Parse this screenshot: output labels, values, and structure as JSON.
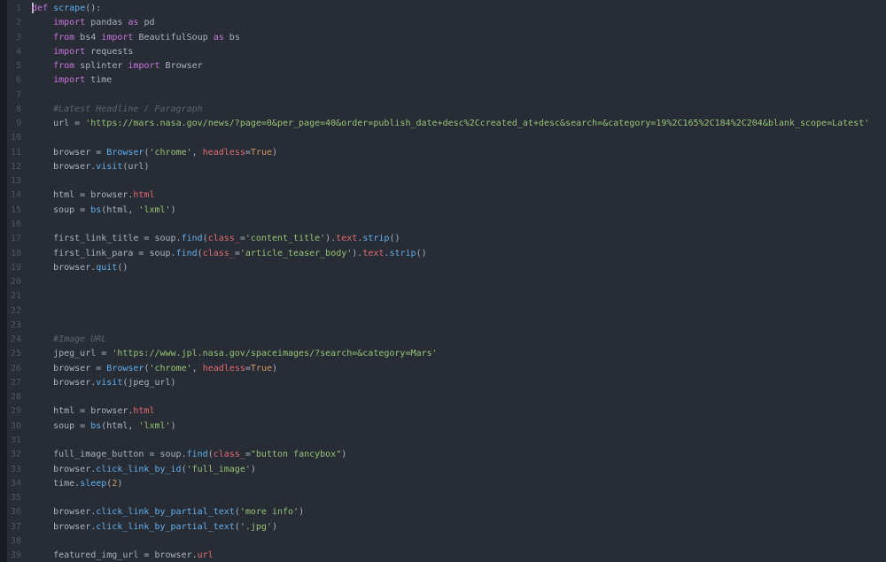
{
  "editor": {
    "colors": {
      "background": "#282c34",
      "left_edge": "#171a1f",
      "line_number": "#4d5666"
    },
    "token_colors": {
      "plain": "#abb2bf",
      "keyword": "#c678dd",
      "function": "#61afef",
      "string": "#98c379",
      "comment": "#5c6370",
      "property": "#e06c75",
      "argument": "#e06c75",
      "number": "#d19a66",
      "cursor": "#b6bdca"
    },
    "cursor_position": {
      "line": 1,
      "column": 1
    },
    "lines": [
      {
        "n": 1,
        "t": [
          [
            "cursor",
            ""
          ],
          [
            "keyword",
            "def"
          ],
          [
            "plain",
            " "
          ],
          [
            "function",
            "scrape"
          ],
          [
            "plain",
            "():"
          ]
        ]
      },
      {
        "n": 2,
        "t": [
          [
            "plain",
            "    "
          ],
          [
            "keyword",
            "import"
          ],
          [
            "plain",
            " pandas "
          ],
          [
            "keyword",
            "as"
          ],
          [
            "plain",
            " pd"
          ]
        ]
      },
      {
        "n": 3,
        "t": [
          [
            "plain",
            "    "
          ],
          [
            "keyword",
            "from"
          ],
          [
            "plain",
            " bs4 "
          ],
          [
            "keyword",
            "import"
          ],
          [
            "plain",
            " BeautifulSoup "
          ],
          [
            "keyword",
            "as"
          ],
          [
            "plain",
            " bs"
          ]
        ]
      },
      {
        "n": 4,
        "t": [
          [
            "plain",
            "    "
          ],
          [
            "keyword",
            "import"
          ],
          [
            "plain",
            " requests"
          ]
        ]
      },
      {
        "n": 5,
        "t": [
          [
            "plain",
            "    "
          ],
          [
            "keyword",
            "from"
          ],
          [
            "plain",
            " splinter "
          ],
          [
            "keyword",
            "import"
          ],
          [
            "plain",
            " Browser"
          ]
        ]
      },
      {
        "n": 6,
        "t": [
          [
            "plain",
            "    "
          ],
          [
            "keyword",
            "import"
          ],
          [
            "plain",
            " time"
          ]
        ]
      },
      {
        "n": 7,
        "t": []
      },
      {
        "n": 8,
        "t": [
          [
            "comment",
            "    #Latest Headline / Paragraph"
          ]
        ]
      },
      {
        "n": 9,
        "t": [
          [
            "plain",
            "    url = "
          ],
          [
            "string",
            "'https://mars.nasa.gov/news/?page=0&per_page=40&order=publish_date+desc%2Ccreated_at+desc&search=&category=19%2C165%2C184%2C204&blank_scope=Latest'"
          ]
        ]
      },
      {
        "n": 10,
        "t": []
      },
      {
        "n": 11,
        "t": [
          [
            "plain",
            "    browser = "
          ],
          [
            "function",
            "Browser"
          ],
          [
            "plain",
            "("
          ],
          [
            "string",
            "'chrome'"
          ],
          [
            "plain",
            ", "
          ],
          [
            "argument",
            "headless"
          ],
          [
            "plain",
            "="
          ],
          [
            "number",
            "True"
          ],
          [
            "plain",
            ")"
          ]
        ]
      },
      {
        "n": 12,
        "t": [
          [
            "plain",
            "    browser."
          ],
          [
            "function",
            "visit"
          ],
          [
            "plain",
            "(url)"
          ]
        ]
      },
      {
        "n": 13,
        "t": []
      },
      {
        "n": 14,
        "t": [
          [
            "plain",
            "    html = browser."
          ],
          [
            "property",
            "html"
          ]
        ]
      },
      {
        "n": 15,
        "t": [
          [
            "plain",
            "    soup = "
          ],
          [
            "function",
            "bs"
          ],
          [
            "plain",
            "(html, "
          ],
          [
            "string",
            "'lxml'"
          ],
          [
            "plain",
            ")"
          ]
        ]
      },
      {
        "n": 16,
        "t": []
      },
      {
        "n": 17,
        "t": [
          [
            "plain",
            "    first_link_title = soup."
          ],
          [
            "function",
            "find"
          ],
          [
            "plain",
            "("
          ],
          [
            "argument",
            "class_"
          ],
          [
            "plain",
            "="
          ],
          [
            "string",
            "'content_title'"
          ],
          [
            "plain",
            ")."
          ],
          [
            "property",
            "text"
          ],
          [
            "plain",
            "."
          ],
          [
            "function",
            "strip"
          ],
          [
            "plain",
            "()"
          ]
        ]
      },
      {
        "n": 18,
        "t": [
          [
            "plain",
            "    first_link_para = soup."
          ],
          [
            "function",
            "find"
          ],
          [
            "plain",
            "("
          ],
          [
            "argument",
            "class_"
          ],
          [
            "plain",
            "="
          ],
          [
            "string",
            "'article_teaser_body'"
          ],
          [
            "plain",
            ")."
          ],
          [
            "property",
            "text"
          ],
          [
            "plain",
            "."
          ],
          [
            "function",
            "strip"
          ],
          [
            "plain",
            "()"
          ]
        ]
      },
      {
        "n": 19,
        "t": [
          [
            "plain",
            "    browser."
          ],
          [
            "function",
            "quit"
          ],
          [
            "plain",
            "()"
          ]
        ]
      },
      {
        "n": 20,
        "t": []
      },
      {
        "n": 21,
        "t": []
      },
      {
        "n": 22,
        "t": []
      },
      {
        "n": 23,
        "t": []
      },
      {
        "n": 24,
        "t": [
          [
            "comment",
            "    #Image URL"
          ]
        ]
      },
      {
        "n": 25,
        "t": [
          [
            "plain",
            "    jpeg_url = "
          ],
          [
            "string",
            "'https://www.jpl.nasa.gov/spaceimages/?search=&category=Mars'"
          ]
        ]
      },
      {
        "n": 26,
        "t": [
          [
            "plain",
            "    browser = "
          ],
          [
            "function",
            "Browser"
          ],
          [
            "plain",
            "("
          ],
          [
            "string",
            "'chrome'"
          ],
          [
            "plain",
            ", "
          ],
          [
            "argument",
            "headless"
          ],
          [
            "plain",
            "="
          ],
          [
            "number",
            "True"
          ],
          [
            "plain",
            ")"
          ]
        ]
      },
      {
        "n": 27,
        "t": [
          [
            "plain",
            "    browser."
          ],
          [
            "function",
            "visit"
          ],
          [
            "plain",
            "(jpeg_url)"
          ]
        ]
      },
      {
        "n": 28,
        "t": []
      },
      {
        "n": 29,
        "t": [
          [
            "plain",
            "    html = browser."
          ],
          [
            "property",
            "html"
          ]
        ]
      },
      {
        "n": 30,
        "t": [
          [
            "plain",
            "    soup = "
          ],
          [
            "function",
            "bs"
          ],
          [
            "plain",
            "(html, "
          ],
          [
            "string",
            "'lxml'"
          ],
          [
            "plain",
            ")"
          ]
        ]
      },
      {
        "n": 31,
        "t": []
      },
      {
        "n": 32,
        "t": [
          [
            "plain",
            "    full_image_button = soup."
          ],
          [
            "function",
            "find"
          ],
          [
            "plain",
            "("
          ],
          [
            "argument",
            "class_"
          ],
          [
            "plain",
            "="
          ],
          [
            "string",
            "\"button fancybox\""
          ],
          [
            "plain",
            ")"
          ]
        ]
      },
      {
        "n": 33,
        "t": [
          [
            "plain",
            "    browser."
          ],
          [
            "function",
            "click_link_by_id"
          ],
          [
            "plain",
            "("
          ],
          [
            "string",
            "'full_image'"
          ],
          [
            "plain",
            ")"
          ]
        ]
      },
      {
        "n": 34,
        "t": [
          [
            "plain",
            "    time."
          ],
          [
            "function",
            "sleep"
          ],
          [
            "plain",
            "("
          ],
          [
            "number",
            "2"
          ],
          [
            "plain",
            ")"
          ]
        ]
      },
      {
        "n": 35,
        "t": []
      },
      {
        "n": 36,
        "t": [
          [
            "plain",
            "    browser."
          ],
          [
            "function",
            "click_link_by_partial_text"
          ],
          [
            "plain",
            "("
          ],
          [
            "string",
            "'more info'"
          ],
          [
            "plain",
            ")"
          ]
        ]
      },
      {
        "n": 37,
        "t": [
          [
            "plain",
            "    browser."
          ],
          [
            "function",
            "click_link_by_partial_text"
          ],
          [
            "plain",
            "("
          ],
          [
            "string",
            "'.jpg'"
          ],
          [
            "plain",
            ")"
          ]
        ]
      },
      {
        "n": 38,
        "t": []
      },
      {
        "n": 39,
        "t": [
          [
            "plain",
            "    featured_img_url = browser."
          ],
          [
            "property",
            "url"
          ]
        ]
      }
    ]
  }
}
